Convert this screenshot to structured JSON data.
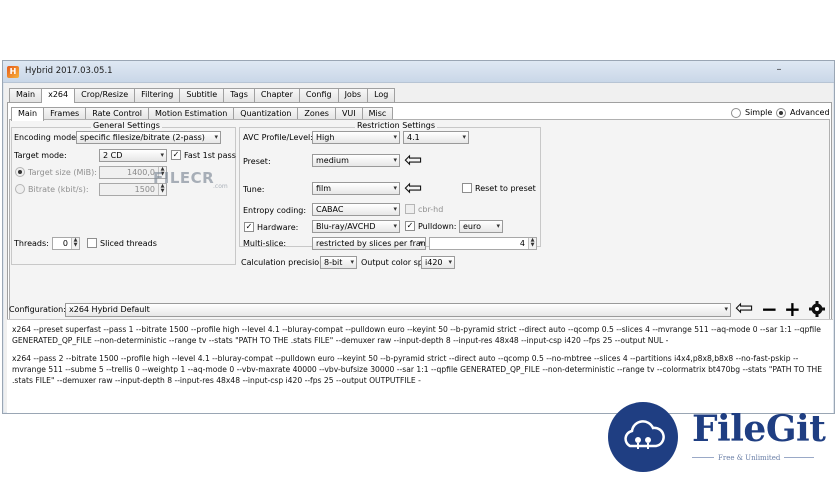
{
  "window": {
    "title": "Hybrid 2017.03.05.1",
    "minimize_glyph": "–",
    "app_icon": "H"
  },
  "main_tabs": [
    "Main",
    "x264",
    "Crop/Resize",
    "Filtering",
    "Subtitle",
    "Tags",
    "Chapter",
    "Config",
    "Jobs",
    "Log"
  ],
  "main_tabs_active": 1,
  "sub_tabs": [
    "Main",
    "Frames",
    "Rate Control",
    "Motion Estimation",
    "Quantization",
    "Zones",
    "VUI",
    "Misc"
  ],
  "sub_tabs_active": 0,
  "mode": {
    "simple_label": "Simple",
    "advanced_label": "Advanced",
    "selected": "Advanced"
  },
  "general": {
    "title": "General Settings",
    "encoding_mode_label": "Encoding mode:",
    "encoding_mode_value": "specific filesize/bitrate (2-pass)",
    "target_mode_label": "Target mode:",
    "target_mode_value": "2 CD",
    "fast_first_pass_label": "Fast 1st pass",
    "fast_first_pass_checked": true,
    "target_size_label": "Target size (MiB):",
    "target_size_value": "1400,0",
    "bitrate_label": "Bitrate (kbit/s):",
    "bitrate_value": "1500",
    "threads_label": "Threads:",
    "threads_value": "0",
    "sliced_threads_label": "Sliced threads",
    "sliced_threads_checked": false
  },
  "restriction": {
    "title": "Restriction Settings",
    "avc_label": "AVC Profile/Level:",
    "avc_profile": "High",
    "avc_level": "4.1",
    "preset_label": "Preset:",
    "preset_value": "medium",
    "tune_label": "Tune:",
    "tune_value": "film",
    "reset_to_preset_label": "Reset to preset",
    "entropy_label": "Entropy coding:",
    "entropy_value": "CABAC",
    "cbr_hd_label": "cbr-hd",
    "hardware_label": "Hardware:",
    "hardware_checked": true,
    "hardware_value": "Blu-ray/AVCHD",
    "pulldown_label": "Pulldown:",
    "pulldown_checked": true,
    "pulldown_value": "euro",
    "multislice_label": "Multi-slice:",
    "multislice_value": "restricted by slices per frame",
    "multislice_count": "4",
    "calc_precision_label": "Calculation precision:",
    "calc_precision_value": "8-bit",
    "output_color_label": "Output color space:",
    "output_color_value": "i420"
  },
  "watermark": {
    "text": "FILECR",
    "suffix": ".com"
  },
  "configuration": {
    "label": "Configuration:",
    "value": "x264 Hybrid Default",
    "btn_back": "⇦",
    "btn_minus": "−",
    "btn_plus": "+"
  },
  "output_lines": [
    "x264 --preset superfast --pass 1 --bitrate 1500 --profile high --level 4.1 --bluray-compat --pulldown euro --keyint 50 --b-pyramid strict --direct auto --qcomp 0.5 --slices 4 --mvrange 511 --aq-mode 0 --sar 1:1 --qpfile GENERATED_QP_FILE --non-deterministic --range tv --stats \"PATH TO THE .stats FILE\" --demuxer raw --input-depth 8 --input-res 48x48 --input-csp i420 --fps 25 --output NUL -",
    "x264 --pass 2 --bitrate 1500 --profile high --level 4.1 --bluray-compat --pulldown euro --keyint 50 --b-pyramid strict --direct auto --qcomp 0.5 --no-mbtree --slices 4 --partitions i4x4,p8x8,b8x8 --no-fast-pskip --mvrange 511 --subme 5 --trellis 0 --weightp 1 --aq-mode 0 --vbv-maxrate 40000 --vbv-bufsize 30000 --sar 1:1 --qpfile GENERATED_QP_FILE --non-deterministic --range tv --colormatrix bt470bg --stats \"PATH TO THE .stats FILE\" --demuxer raw --input-depth 8 --input-res 48x48 --input-csp i420 --fps 25 --output OUTPUTFILE -"
  ],
  "filegit": {
    "name": "FileGit",
    "tagline": "Free & Unlimited"
  },
  "colors": {
    "filegit_blue": "#1f3e82",
    "title_bar": "#c9d7e8"
  }
}
